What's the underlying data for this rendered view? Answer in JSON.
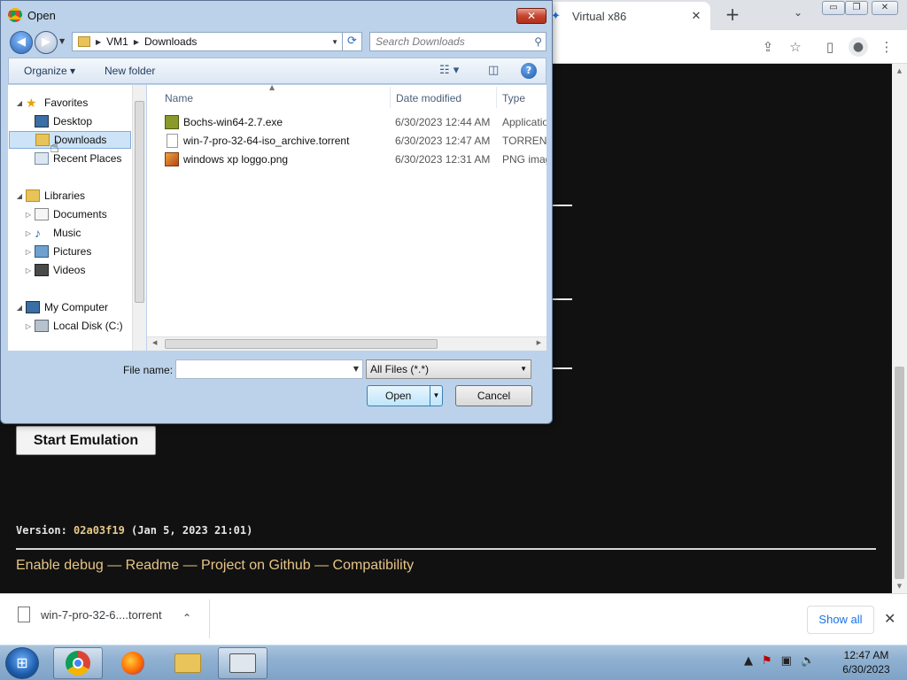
{
  "browser": {
    "tab_title": "Virtual x86",
    "tab_close": "✕",
    "new_tab": "+",
    "tab_list": "⌄",
    "window_controls": {
      "minimize": "▭",
      "restore": "❐",
      "close": "✕"
    },
    "toolbar_icons": {
      "share": "⇪",
      "bookmark": "☆",
      "sidepanel": "▯",
      "profile": "●",
      "menu": "⋮"
    }
  },
  "page": {
    "start_button": "Start Emulation",
    "version_label": "Version: ",
    "version_hash": "02a03f19",
    "version_date": " (Jan 5, 2023 21:01)",
    "links": [
      "Enable debug",
      "Readme",
      "Project on Github",
      "Compatibility"
    ],
    "link_separator": " — "
  },
  "downloads_bar": {
    "file_name": "win-7-pro-32-6....torrent",
    "chevron": "⌃",
    "show_all": "Show all",
    "close": "✕"
  },
  "dialog": {
    "title": "Open",
    "close": "✕",
    "breadcrumb": [
      "VM1",
      "Downloads"
    ],
    "search_placeholder": "Search Downloads",
    "commands": {
      "organize": "Organize ▾",
      "new_folder": "New folder"
    },
    "nav_tree": [
      {
        "label": "Favorites",
        "icon": "star-icon",
        "level": 0
      },
      {
        "label": "Desktop",
        "icon": "desktop-icon",
        "level": 1
      },
      {
        "label": "Downloads",
        "icon": "folder-icon",
        "level": 1,
        "selected": true
      },
      {
        "label": "Recent Places",
        "icon": "recent-icon",
        "level": 1
      },
      {
        "label": "Libraries",
        "icon": "library-icon",
        "level": 0
      },
      {
        "label": "Documents",
        "icon": "documents-icon",
        "level": 1
      },
      {
        "label": "Music",
        "icon": "music-icon",
        "level": 1
      },
      {
        "label": "Pictures",
        "icon": "pictures-icon",
        "level": 1
      },
      {
        "label": "Videos",
        "icon": "videos-icon",
        "level": 1
      },
      {
        "label": "My Computer",
        "icon": "computer-icon",
        "level": 0
      },
      {
        "label": "Local Disk (C:)",
        "icon": "disk-icon",
        "level": 1
      }
    ],
    "columns": {
      "name": "Name",
      "date": "Date modified",
      "type": "Type"
    },
    "files": [
      {
        "name": "Bochs-win64-2.7.exe",
        "date": "6/30/2023 12:44 AM",
        "type": "Applicatio",
        "icon": "installer-icon"
      },
      {
        "name": "win-7-pro-32-64-iso_archive.torrent",
        "date": "6/30/2023 12:47 AM",
        "type": "TORRENT",
        "icon": "file-icon"
      },
      {
        "name": "windows xp loggo.png",
        "date": "6/30/2023 12:31 AM",
        "type": "PNG imag",
        "icon": "image-icon"
      }
    ],
    "file_name_label": "File name:",
    "file_name_value": "",
    "filter": "All Files (*.*)",
    "open_button": "Open",
    "cancel_button": "Cancel"
  },
  "taskbar": {
    "time": "12:47 AM",
    "date": "6/30/2023"
  }
}
